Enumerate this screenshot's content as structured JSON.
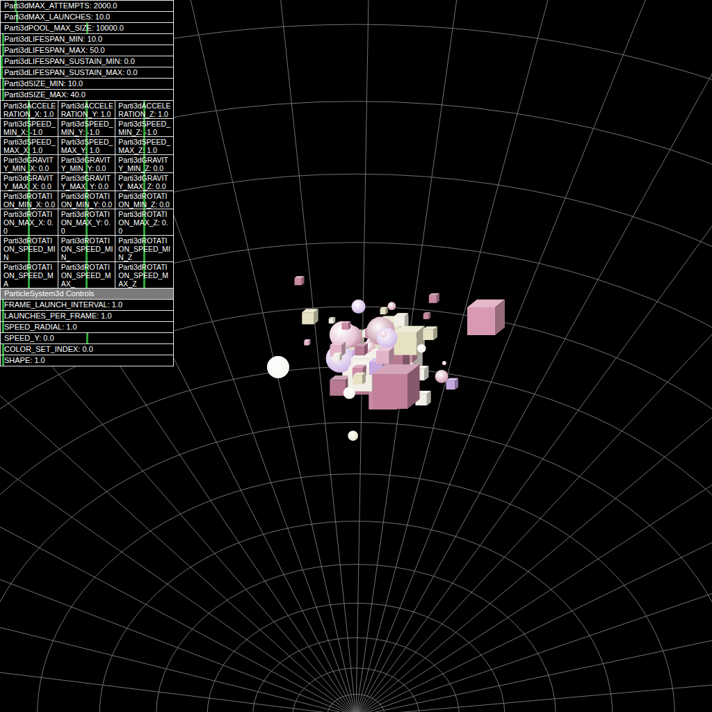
{
  "panel": {
    "rows": [
      {
        "kind": "slider",
        "label": "Parti3dMAX_ATTEMPTS: 2000.0",
        "level": 0.08
      },
      {
        "kind": "slider",
        "label": "Parti3dMAX_LAUNCHES: 10.0",
        "level": 0.09
      },
      {
        "kind": "slider",
        "label": "Parti3dPOOL_MAX_SIZE: 10000.0",
        "level": 0.5
      },
      {
        "kind": "slider",
        "label": "Parti3dLIFESPAN_MIN: 10.0",
        "level": 0.01
      },
      {
        "kind": "slider",
        "label": "Parti3dLIFESPAN_MAX: 50.0",
        "level": 0.01
      },
      {
        "kind": "slider",
        "label": "Parti3dLIFESPAN_SUSTAIN_MIN: 0.0",
        "level": 0.0
      },
      {
        "kind": "slider",
        "label": "Parti3dLIFESPAN_SUSTAIN_MAX: 0.0",
        "level": 0.0
      },
      {
        "kind": "slider",
        "label": "Parti3dSIZE_MIN: 10.0",
        "level": 0.01
      },
      {
        "kind": "slider",
        "label": "Parti3dSIZE_MAX: 40.0",
        "level": 0.01
      },
      {
        "kind": "triple",
        "cells": [
          {
            "label": "Parti3dACCELERATION_X: 1.0",
            "level": 0.5
          },
          {
            "label": "Parti3dACCELERATION_Y: 1.0",
            "level": 0.5
          },
          {
            "label": "Parti3dACCELERATION_Z: 1.0",
            "level": 0.5
          }
        ]
      },
      {
        "kind": "triple",
        "cells": [
          {
            "label": "Parti3dSPEED_MIN_X: -1.0",
            "level": 0.5
          },
          {
            "label": "Parti3dSPEED_MIN_Y: -1.0",
            "level": 0.5
          },
          {
            "label": "Parti3dSPEED_MIN_Z: -1.0",
            "level": 0.5
          }
        ]
      },
      {
        "kind": "triple",
        "cells": [
          {
            "label": "Parti3dSPEED_MAX_X: 1.0",
            "level": 0.5
          },
          {
            "label": "Parti3dSPEED_MAX_Y: 1.0",
            "level": 0.5
          },
          {
            "label": "Parti3dSPEED_MAX_Z: 1.0",
            "level": 0.5
          }
        ]
      },
      {
        "kind": "triple",
        "cells": [
          {
            "label": "Parti3dGRAVITY_MIN_X: 0.0",
            "level": 0.5
          },
          {
            "label": "Parti3dGRAVITY_MIN_Y: 0.0",
            "level": 0.5
          },
          {
            "label": "Parti3dGRAVITY_MIN_Z: 0.0",
            "level": 0.5
          }
        ]
      },
      {
        "kind": "triple",
        "cells": [
          {
            "label": "Parti3dGRAVITY_MAX_X: 0.0",
            "level": 0.5
          },
          {
            "label": "Parti3dGRAVITY_MAX_Y: 0.0",
            "level": 0.5
          },
          {
            "label": "Parti3dGRAVITY_MAX_Z: 0.0",
            "level": 0.5
          }
        ]
      },
      {
        "kind": "triple",
        "cells": [
          {
            "label": "Parti3dROTATION_MIN_X: 0.0",
            "level": 0.5
          },
          {
            "label": "Parti3dROTATION_MIN_Y: 0.0",
            "level": 0.5
          },
          {
            "label": "Parti3dROTATION_MIN_Z: 0.0",
            "level": 0.5
          }
        ]
      },
      {
        "kind": "triple",
        "cells": [
          {
            "label": "Parti3dROTATION_MAX_X: 0.0",
            "level": 0.5
          },
          {
            "label": "Parti3dROTATION_MAX_Y: 0.0",
            "level": 0.5
          },
          {
            "label": "Parti3dROTATION_MAX_Z: 0.0",
            "level": 0.5
          }
        ]
      },
      {
        "kind": "triple",
        "cells": [
          {
            "label": "Parti3dROTATION_SPEED_MIN",
            "level": 0.5
          },
          {
            "label": "Parti3dROTATION_SPEED_MIN_",
            "level": 0.5
          },
          {
            "label": "Parti3dROTATION_SPEED_MIN_Z",
            "level": 0.5
          }
        ]
      },
      {
        "kind": "triple",
        "cells": [
          {
            "label": "Parti3dROTATION_SPEED_MA",
            "level": 0.5
          },
          {
            "label": "Parti3dROTATION_SPEED_MAX_",
            "level": 0.5
          },
          {
            "label": "Parti3dROTATION_SPEED_MAX_Z",
            "level": 0.5
          }
        ]
      },
      {
        "kind": "header",
        "label": "ParticleSystem3d Controls"
      },
      {
        "kind": "slider",
        "label": "FRAME_LAUNCH_INTERVAL: 1.0",
        "level": 0.01
      },
      {
        "kind": "slider",
        "label": "LAUNCHES_PER_FRAME: 1.0",
        "level": 0.01
      },
      {
        "kind": "slider",
        "label": "SPEED_RADIAL: 1.0",
        "level": 0.01
      },
      {
        "kind": "slider",
        "label": "SPEED_Y: 0.0",
        "level": 0.5
      },
      {
        "kind": "slider",
        "label": "COLOR_SET_INDEX: 0.0",
        "level": 0.01
      },
      {
        "kind": "slider",
        "label": "SHAPE: 1.0",
        "level": 0.01
      }
    ]
  }
}
